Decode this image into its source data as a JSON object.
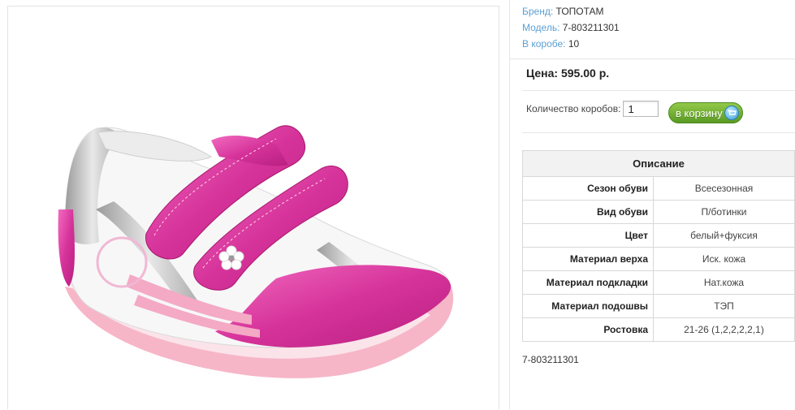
{
  "product": {
    "brand_label": "Бренд:",
    "brand": "ТОПОТАМ",
    "model_label": "Модель:",
    "model": "7-803211301",
    "box_label": "В коробе:",
    "box_qty": "10",
    "price": "Цена: 595.00 р.",
    "qty_label": "Количество коробов:",
    "qty_value": "1",
    "cart_button": "в корзину",
    "sku_footer": "7-803211301",
    "image_icon": "shoe-photo"
  },
  "description": {
    "header": "Описание",
    "rows": [
      {
        "key": "Сезон обуви",
        "value": "Всесезонная"
      },
      {
        "key": "Вид обуви",
        "value": "П/ботинки"
      },
      {
        "key": "Цвет",
        "value": "белый+фуксия"
      },
      {
        "key": "Материал верха",
        "value": "Иск. кожа"
      },
      {
        "key": "Материал подкладки",
        "value": "Нат.кожа"
      },
      {
        "key": "Материал подошвы",
        "value": "ТЭП"
      },
      {
        "key": "Ростовка",
        "value": "21-26 (1,2,2,2,2,1)"
      }
    ]
  },
  "colors": {
    "label_blue": "#5a9fd4",
    "cart_green": "#6aab2e",
    "shoe_pink": "#e0409e"
  }
}
